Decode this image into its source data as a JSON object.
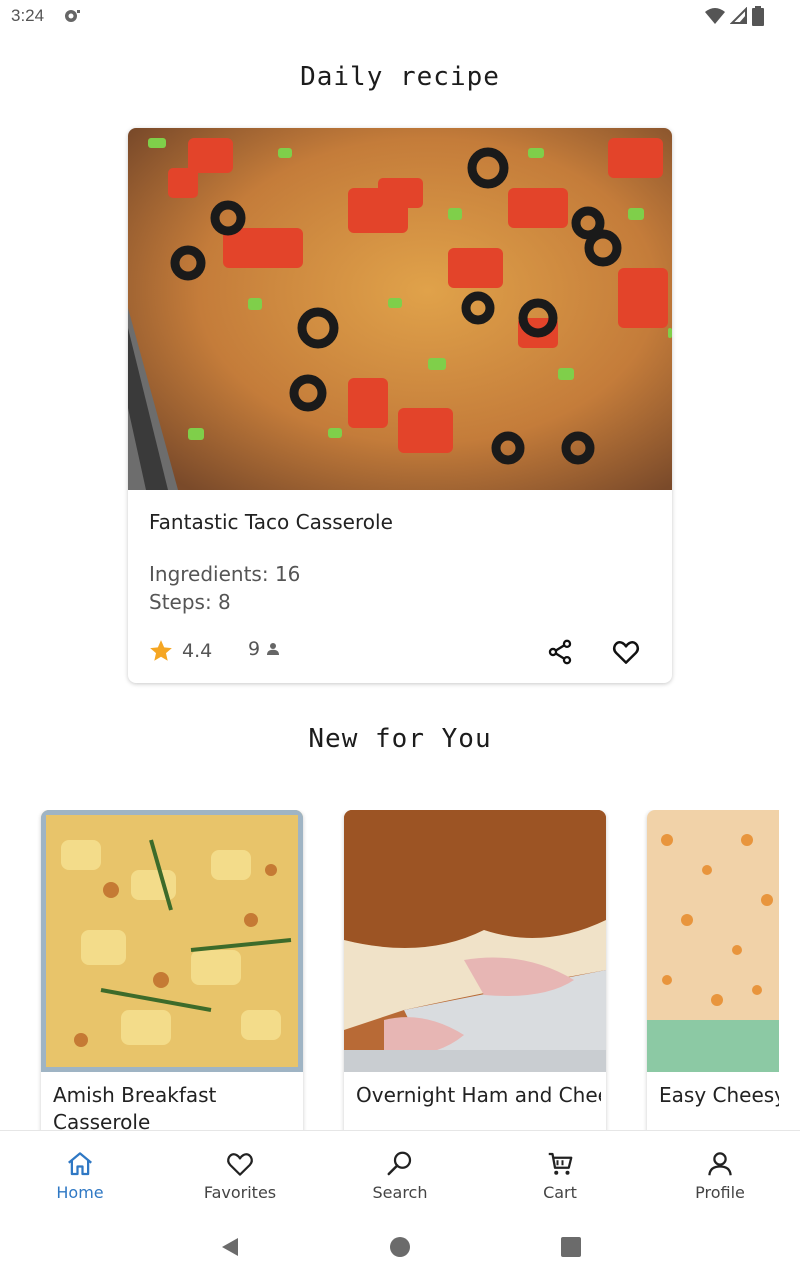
{
  "status": {
    "time": "3:24"
  },
  "daily": {
    "section_title": "Daily recipe",
    "name": "Fantastic Taco Casserole",
    "ingredients": "Ingredients: 16",
    "steps": "Steps: 8",
    "rating": "4.4",
    "reviews": "9"
  },
  "new_for_you": {
    "section_title": "New for You",
    "items": [
      {
        "title": "Amish Breakfast Casserole"
      },
      {
        "title": "Overnight Ham and Cheese Breakfast Cass..."
      },
      {
        "title": "Easy Cheesy Casserole"
      }
    ]
  },
  "nav": {
    "items": [
      {
        "label": "Home",
        "icon": "home-icon",
        "active": true
      },
      {
        "label": "Favorites",
        "icon": "heart-icon",
        "active": false
      },
      {
        "label": "Search",
        "icon": "search-icon",
        "active": false
      },
      {
        "label": "Cart",
        "icon": "cart-icon",
        "active": false
      },
      {
        "label": "Profile",
        "icon": "person-icon",
        "active": false
      }
    ]
  },
  "colors": {
    "accent": "#2f78c4",
    "star": "#f5a623",
    "text": "#222222"
  }
}
